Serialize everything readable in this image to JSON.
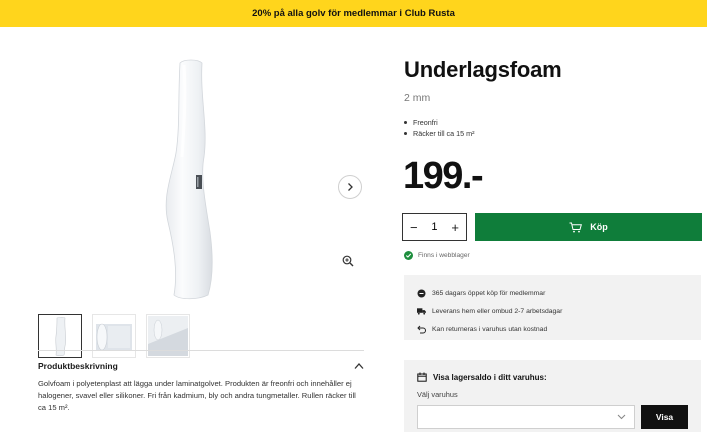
{
  "promo": {
    "text": "20% på alla golv för medlemmar i Club Rusta"
  },
  "gallery": {
    "thumbnails": [
      {
        "name": "thumbnail-1",
        "active": true
      },
      {
        "name": "thumbnail-2",
        "active": false
      },
      {
        "name": "thumbnail-3",
        "active": false
      }
    ],
    "icons": {
      "next": "chevron-right-icon",
      "zoom": "zoom-icon"
    }
  },
  "description": {
    "title": "Produktbeskrivning",
    "text": "Golvfoam i polyetenplast att lägga under laminatgolvet. Produkten är freonfri och innehåller ej halogener, svavel eller silikoner. Fri från kadmium, bly och andra tungmetaller. Rullen räcker till ca 15 m²."
  },
  "product": {
    "title": "Underlagsfoam",
    "size": "2 mm",
    "features": [
      "Freonfri",
      "Räcker till ca 15 m²"
    ],
    "price": "199.-",
    "quantity": "1",
    "buy_label": "Köp",
    "stock_status": "Finns i webblager"
  },
  "benefits": [
    {
      "icon": "member-icon",
      "text": "365 dagars öppet köp för medlemmar"
    },
    {
      "icon": "truck-icon",
      "text": "Leverans hem eller ombud 2-7 arbetsdagar"
    },
    {
      "icon": "return-icon",
      "text": "Kan returneras i varuhus utan kostnad"
    }
  ],
  "stock_check": {
    "title": "Visa lagersaldo i ditt varuhus:",
    "label": "Välj varuhus",
    "selected": "",
    "button": "Visa"
  },
  "colors": {
    "promo": "#ffd51c",
    "buy": "#0f7d3a",
    "stock_ok": "#1e8e3e",
    "panel": "#f2f2f2"
  }
}
